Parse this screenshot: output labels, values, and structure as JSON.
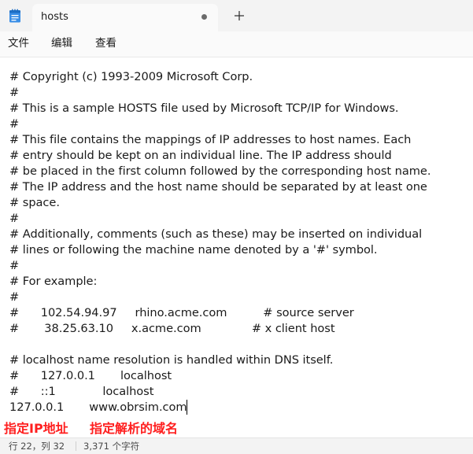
{
  "window": {
    "tab_title": "hosts",
    "unsaved_indicator": "dot",
    "new_tab_label": "+",
    "app_icon": "notepad-icon"
  },
  "menu": {
    "file": "文件",
    "edit": "编辑",
    "view": "查看"
  },
  "document": {
    "lines": [
      "# Copyright (c) 1993-2009 Microsoft Corp.",
      "#",
      "# This is a sample HOSTS file used by Microsoft TCP/IP for Windows.",
      "#",
      "# This file contains the mappings of IP addresses to host names. Each",
      "# entry should be kept on an individual line. The IP address should",
      "# be placed in the first column followed by the corresponding host name.",
      "# The IP address and the host name should be separated by at least one",
      "# space.",
      "#",
      "# Additionally, comments (such as these) may be inserted on individual",
      "# lines or following the machine name denoted by a '#' symbol.",
      "#",
      "# For example:",
      "#",
      "#      102.54.94.97     rhino.acme.com          # source server",
      "#       38.25.63.10     x.acme.com              # x client host",
      "",
      "# localhost name resolution is handled within DNS itself.",
      "#      127.0.0.1       localhost",
      "#      ::1             localhost",
      "127.0.0.1       www.obrsim.com"
    ]
  },
  "annotations": {
    "ip_label": "指定IP地址",
    "domain_label": "指定解析的域名",
    "color": "#ff1f1f"
  },
  "status": {
    "position": "行 22，列 32",
    "char_count": "3,371 个字符"
  },
  "colors": {
    "tabbar_bg": "#f3f3f3",
    "active_tab_bg": "#fafafa",
    "editor_bg": "#ffffff",
    "text": "#1a1a1a"
  }
}
